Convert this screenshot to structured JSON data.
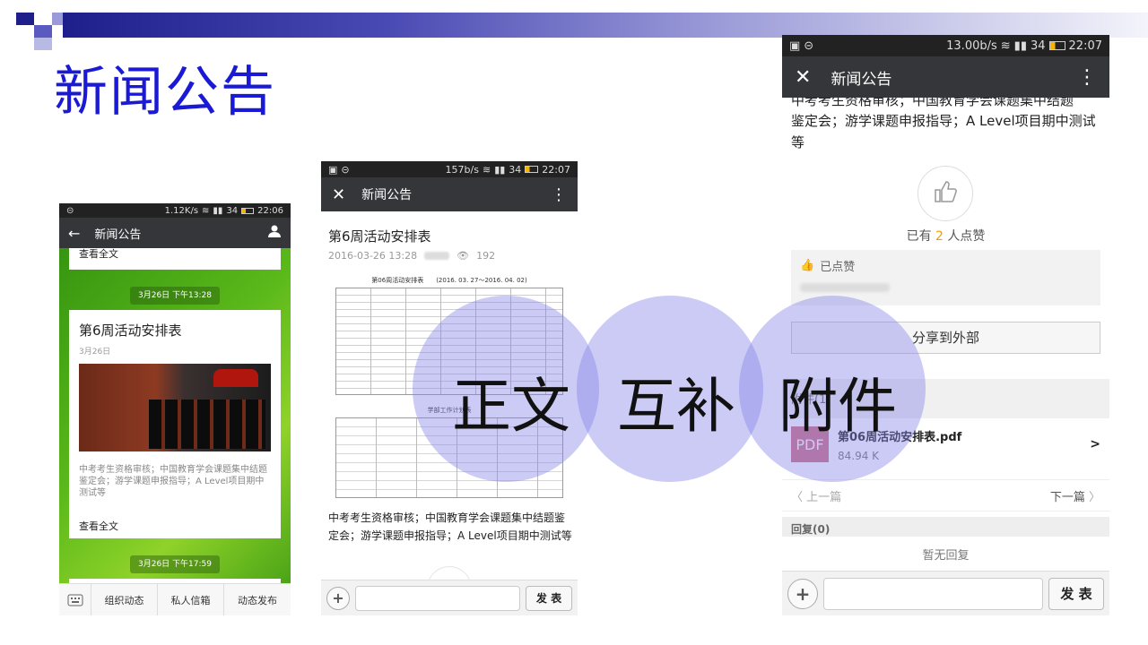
{
  "slide": {
    "title": "新闻公告",
    "overlay_words": [
      "正文",
      "互补",
      "附件"
    ],
    "colors": {
      "title": "#1a1ad6",
      "circle": "#8282e6",
      "accent": "#2f8f0e"
    }
  },
  "phone1": {
    "status": {
      "left_icon": "alarm-icon",
      "speed": "1.12K/s",
      "battery": "34",
      "time": "22:06"
    },
    "nav": {
      "title": "新闻公告",
      "back_icon": "arrow-left-icon",
      "user_icon": "user-icon"
    },
    "top_read_all": "查看全文",
    "date1": "3月26日 下午13:28",
    "card": {
      "title": "第6周活动安排表",
      "date": "3月26日",
      "summary": "中考考生资格审核；中国教育学会课题集中结题鉴定会；游学课题申报指导；A Level项目期中测试等",
      "read_all": "查看全文"
    },
    "date2": "3月26日 下午17:59",
    "bottom_tabs": [
      "组织动态",
      "私人信箱",
      "动态发布"
    ]
  },
  "phone2": {
    "status": {
      "speed": "157b/s",
      "battery": "34",
      "time": "22:07"
    },
    "nav": {
      "title": "新闻公告"
    },
    "article": {
      "title": "第6周活动安排表",
      "datetime": "2016-03-26 13:28",
      "views": "192",
      "table_title": "第06周活动安排表　　(2016. 03. 27～2016. 04. 02)",
      "table2_title": "学部工作计划表",
      "body": "中考考生资格审核；中国教育学会课题集中结题鉴定会；游学课题申报指导；A Level项目期中测试等"
    },
    "compose": {
      "send": "发 表"
    }
  },
  "phone3": {
    "status": {
      "speed": "13.00b/s",
      "battery": "34",
      "time": "22:07"
    },
    "nav": {
      "title": "新闻公告"
    },
    "body_top": "中考考生资格审核；中国教育学会课题集中结题",
    "body": "鉴定会；游学课题申报指导；A Level项目期中测试等",
    "likes": {
      "prefix": "已有 ",
      "count": "2",
      "suffix": " 人点赞",
      "liked_label": "已点赞"
    },
    "share": "分享到外部",
    "attachment": {
      "section": "附件(1)",
      "icon": "PDF",
      "name": "第06周活动安排表.pdf",
      "size": "84.94 K"
    },
    "pager": {
      "prev": "上一篇",
      "next": "下一篇"
    },
    "reply": {
      "header": "回复(0)",
      "empty": "暂无回复"
    },
    "compose": {
      "send": "发 表"
    }
  }
}
